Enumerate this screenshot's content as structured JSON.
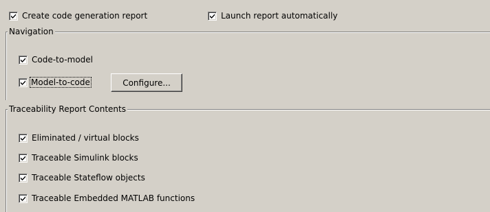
{
  "top_options": [
    {
      "label": "Create code generation report",
      "checked": true
    },
    {
      "label": "Launch report automatically",
      "checked": true
    }
  ],
  "navigation": {
    "title": "Navigation",
    "items": [
      {
        "label": "Code-to-model",
        "checked": true
      },
      {
        "label": "Model-to-code",
        "checked": true
      }
    ],
    "configure_label": "Configure..."
  },
  "traceability": {
    "title": "Traceability Report Contents",
    "items": [
      {
        "label": "Eliminated / virtual blocks",
        "checked": true
      },
      {
        "label": "Traceable Simulink blocks",
        "checked": true
      },
      {
        "label": "Traceable Stateflow objects",
        "checked": true
      },
      {
        "label": "Traceable Embedded MATLAB functions",
        "checked": true
      }
    ]
  },
  "colors": {
    "background": "#d4d0c8",
    "shadow": "#808080",
    "highlight": "#ffffff"
  },
  "icons": {
    "checkmark": "checkmark-icon"
  }
}
